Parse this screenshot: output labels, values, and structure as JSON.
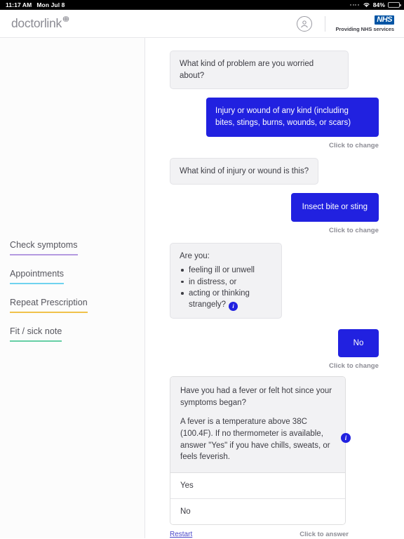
{
  "status_bar": {
    "time": "11:17 AM",
    "date": "Mon Jul 8",
    "battery_percent": "84%",
    "wifi_icon": "wifi-icon",
    "battery_icon": "battery-icon"
  },
  "header": {
    "brand": "doctorlink",
    "brand_mark": "registered-globe-icon",
    "account_icon": "account-circle-icon",
    "nhs_logo": "NHS",
    "nhs_caption": "Providing NHS services"
  },
  "sidebar": {
    "items": [
      {
        "label": "Check symptoms",
        "accent": "#b49ae0"
      },
      {
        "label": "Appointments",
        "accent": "#6fd3ef"
      },
      {
        "label": "Repeat Prescription",
        "accent": "#f0c24b"
      },
      {
        "label": "Fit / sick note",
        "accent": "#66cfa5"
      }
    ]
  },
  "chat": {
    "messages": [
      {
        "role": "bot",
        "text": "What kind of problem are you worried about?"
      },
      {
        "role": "user",
        "text": "Injury or wound of any kind (including bites, stings, burns, wounds, or scars)",
        "hint": "Click to change"
      },
      {
        "role": "bot",
        "text": "What kind of injury or wound is this?"
      },
      {
        "role": "user",
        "text": "Insect bite or sting",
        "hint": "Click to change"
      }
    ],
    "symptom_question": {
      "lead": "Are you:",
      "bullets": [
        "feeling ill or unwell",
        "in distress, or",
        "acting or thinking strangely?"
      ],
      "info_icon": "info-icon",
      "info_glyph": "i"
    },
    "symptom_answer": {
      "text": "No",
      "hint": "Click to change"
    },
    "fever_question": {
      "paragraph_1": "Have you had a fever or felt hot since your symptoms began?",
      "paragraph_2": "A fever is a temperature above 38C (100.4F). If no thermometer is available, answer \"Yes\" if you have chills, sweats, or feels feverish.",
      "info_icon": "info-icon",
      "info_glyph": "i",
      "options": [
        "Yes",
        "No"
      ],
      "restart_label": "Restart",
      "hint": "Click to answer"
    }
  },
  "colors": {
    "primary_blue": "#2121e0",
    "nhs_blue": "#0054a4",
    "link_purple": "#4a47c9",
    "bubble_grey": "#f2f2f4"
  }
}
